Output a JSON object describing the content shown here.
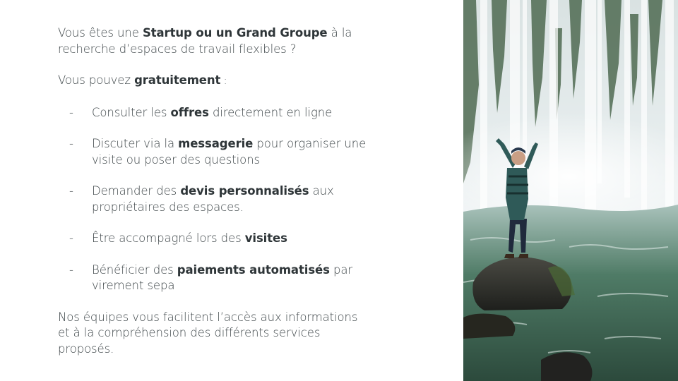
{
  "intro": {
    "pre": "Vous êtes une ",
    "bold": "Startup ou un Grand Groupe",
    "post": " à la recherche d’espaces de travail flexibles ?"
  },
  "lead": {
    "pre": "Vous pouvez ",
    "bold": "gratuitement",
    "post": " :"
  },
  "bullet_marker": "-",
  "bullets": [
    {
      "pre": "Consulter les ",
      "bold": "offres",
      "post": " directement en ligne"
    },
    {
      "pre": "Discuter via la ",
      "bold": "messagerie",
      "post": " pour organiser une visite ou poser des questions"
    },
    {
      "pre": "Demander des ",
      "bold": "devis personnalisés",
      "post": " aux propriétaires des espaces."
    },
    {
      "pre": "Être accompagné lors des ",
      "bold": "visites",
      "post": ""
    },
    {
      "pre": "Bénéficier des ",
      "bold": "paiements automatisés",
      "post": " par virement sepa"
    }
  ],
  "closing": "Nos équipes vous facilitent l’accès aux informations et à la compréhension des différents services proposés.",
  "colors": {
    "text": "#3d4548",
    "water_light": "#eef3f4",
    "water_green": "#3f6a55",
    "rock": "#2f2f2c"
  },
  "photo": {
    "icon": "waterfall-person-photo"
  }
}
